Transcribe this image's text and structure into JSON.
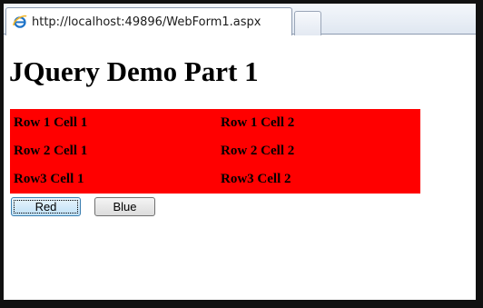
{
  "browser": {
    "tab_title": "http://localhost:49896/WebForm1.aspx",
    "tab_icon": "ie-icon"
  },
  "page": {
    "heading": "JQuery Demo Part 1",
    "table": {
      "bg_color": "#ff0000",
      "rows": [
        [
          "Row 1 Cell 1",
          "Row 1 Cell 2"
        ],
        [
          "Row 2 Cell 1",
          "Row 2 Cell 2"
        ],
        [
          "Row3 Cell 1",
          "Row3 Cell 2"
        ]
      ]
    },
    "buttons": {
      "red_label": "Red",
      "blue_label": "Blue"
    }
  }
}
